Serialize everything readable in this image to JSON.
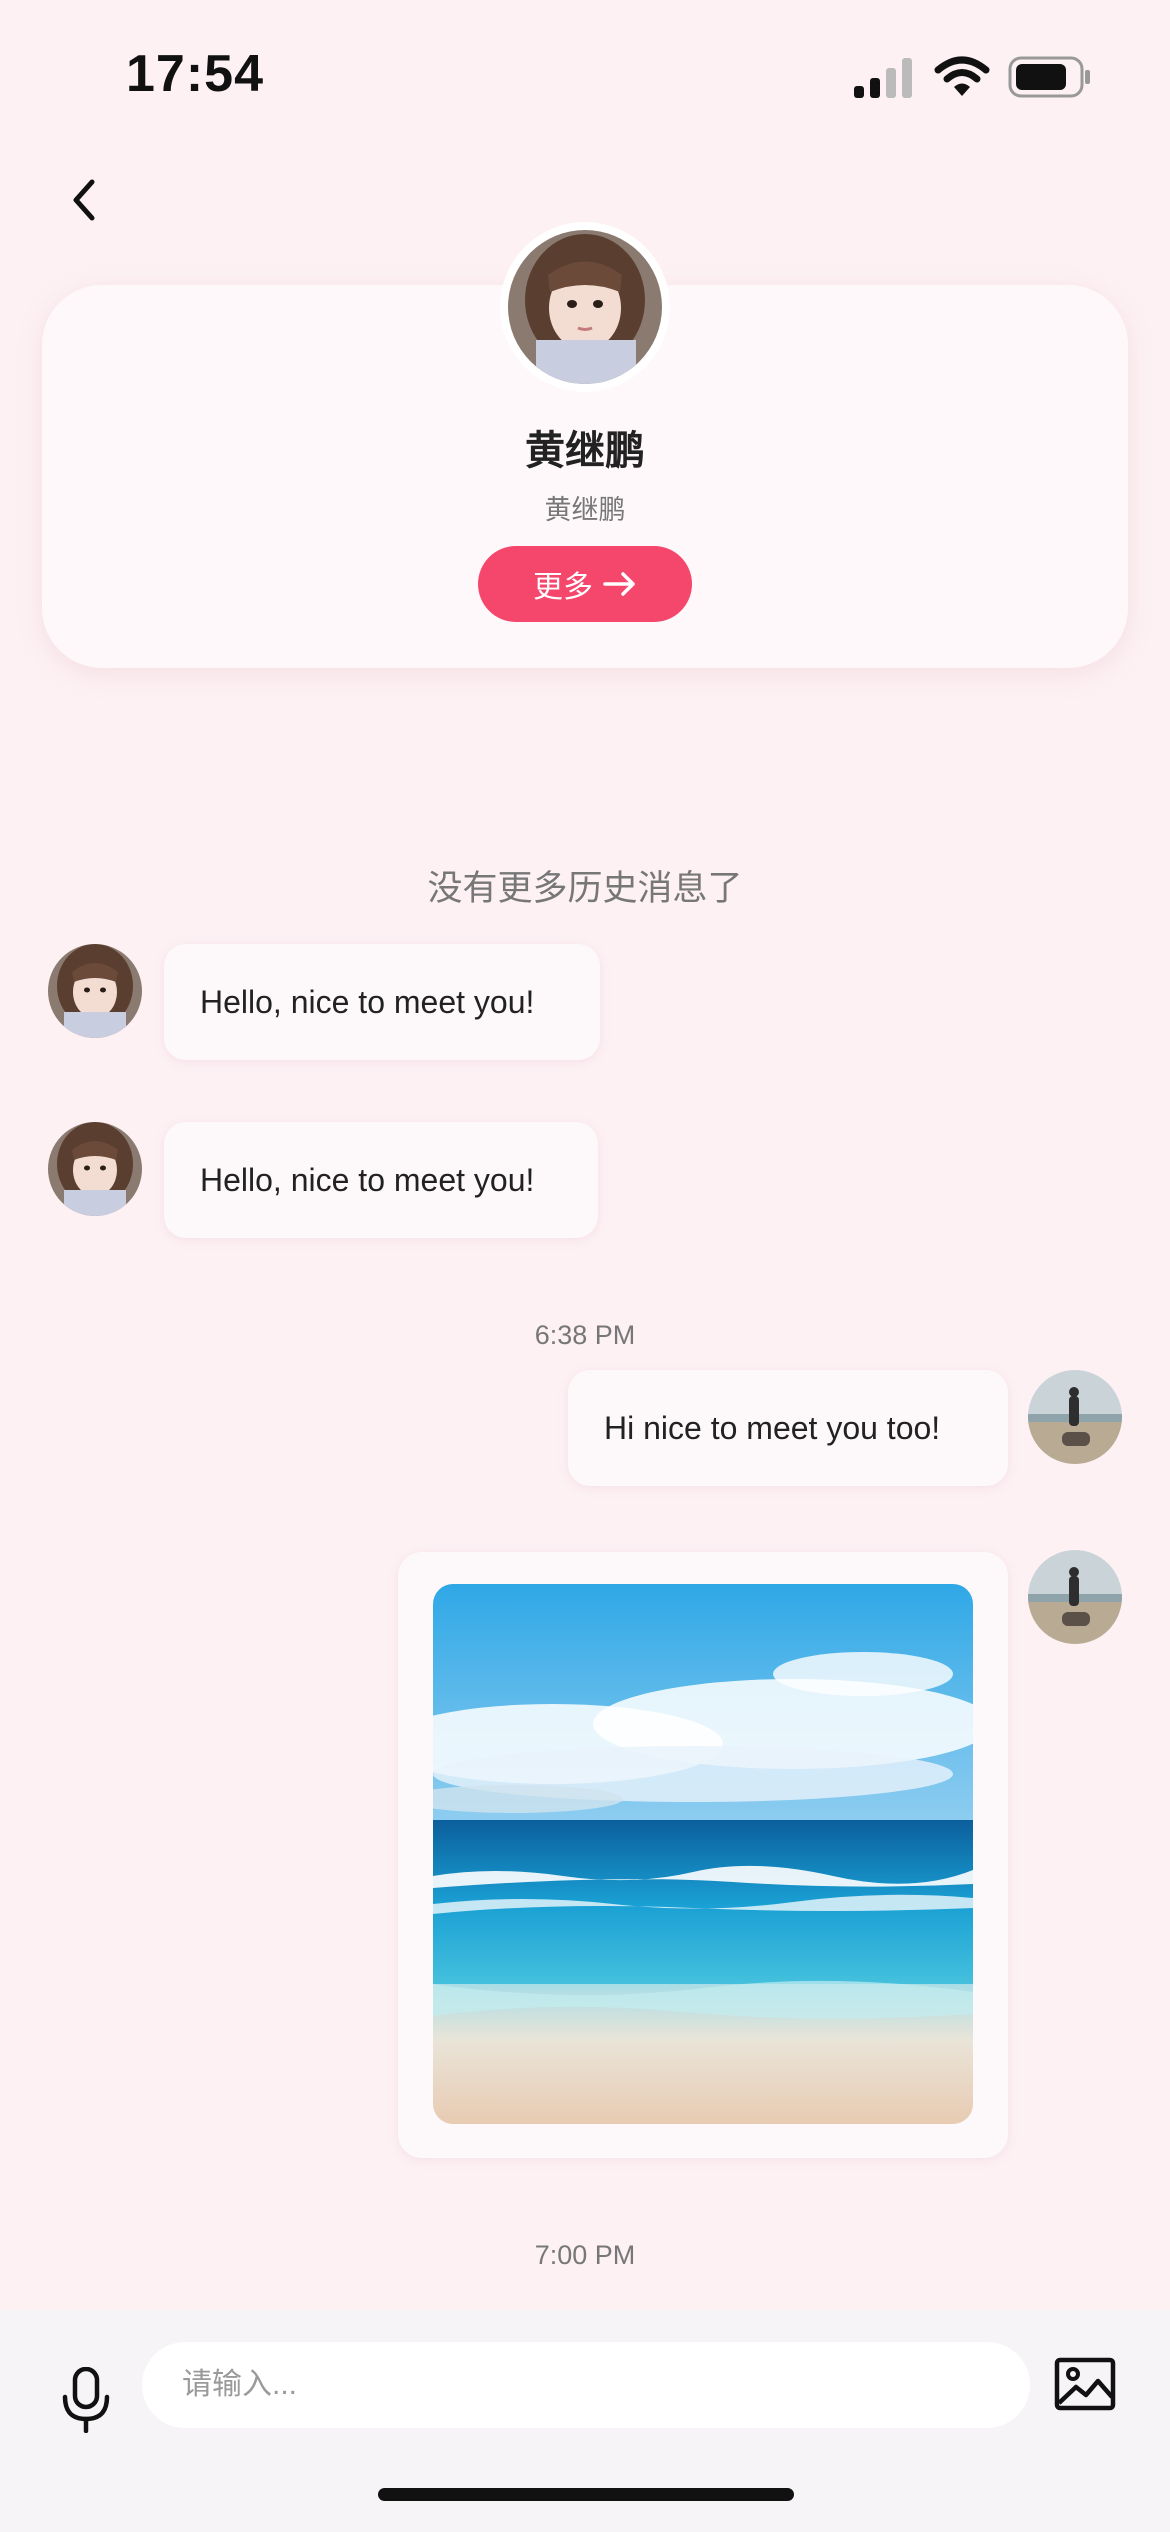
{
  "status_bar": {
    "time": "17:54",
    "icons": [
      "cellular-signal-icon",
      "wifi-icon",
      "battery-icon"
    ]
  },
  "header": {
    "back_icon": "chevron-left-icon"
  },
  "profile": {
    "name": "黄继鹏",
    "subtitle": "黄继鹏",
    "more_label": "更多",
    "more_icon": "arrow-right-icon"
  },
  "chat": {
    "no_more_history": "没有更多历史消息了",
    "messages": [
      {
        "sender": "other",
        "text": "Hello, nice to meet you!"
      },
      {
        "sender": "other",
        "text": "Hello, nice to meet you!"
      },
      {
        "timestamp": "6:38 PM"
      },
      {
        "sender": "self",
        "text": "Hi nice to meet you too!"
      },
      {
        "sender": "self",
        "type": "image",
        "image": "ocean-beach-photo"
      },
      {
        "timestamp": "7:00 PM"
      }
    ]
  },
  "input_bar": {
    "placeholder": "请输入...",
    "mic_icon": "microphone-icon",
    "image_icon": "image-icon"
  },
  "colors": {
    "background": "#fdf1f4",
    "accent": "#f5466c",
    "bubble": "#fdf9fa"
  }
}
